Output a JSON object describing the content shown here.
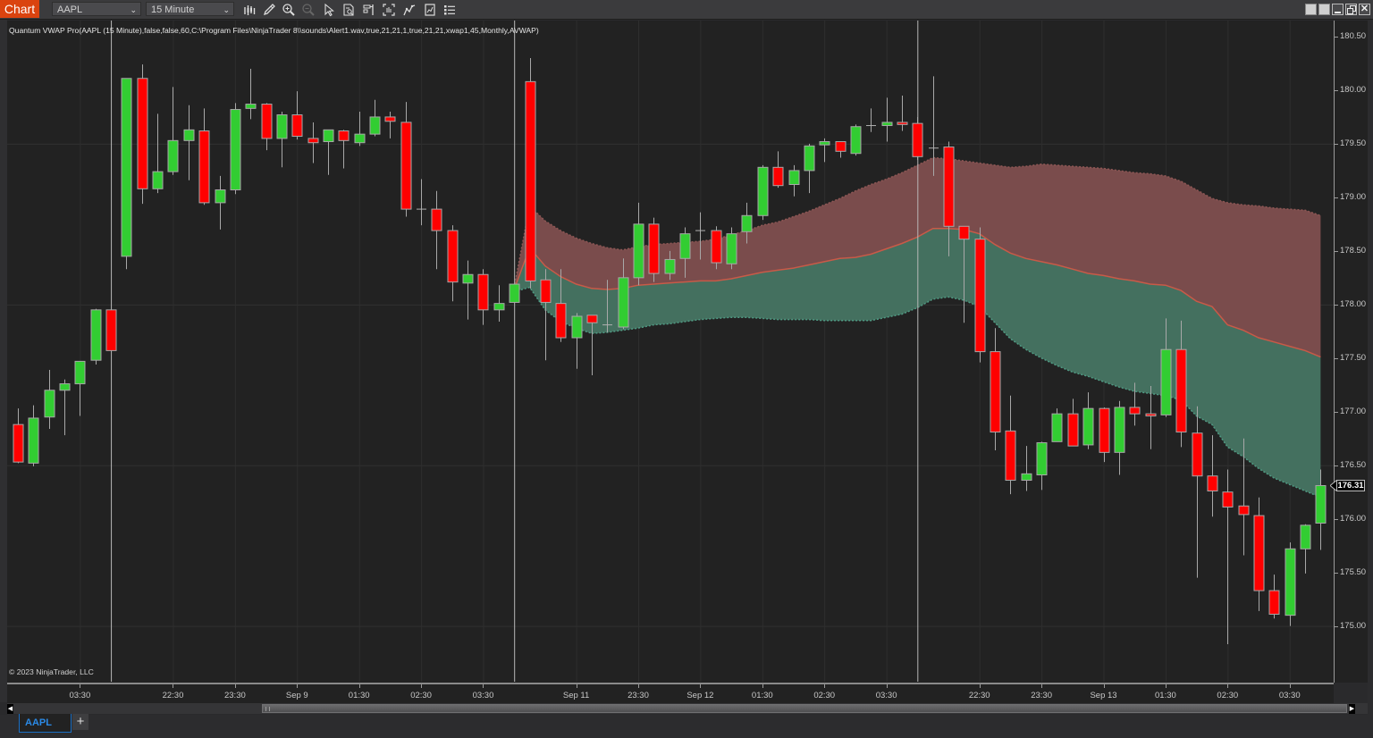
{
  "toolbar": {
    "app_label": "Chart",
    "instrument": "AAPL",
    "timeframe": "15 Minute",
    "icons": [
      "bar-type-icon",
      "drawing-tools-icon",
      "zoom-in-icon",
      "zoom-out-icon",
      "pointer-icon",
      "data-box-icon",
      "chart-trader-icon",
      "snapshot-icon",
      "indicators-icon",
      "strategies-icon",
      "properties-icon"
    ]
  },
  "window_controls": [
    "link-icon",
    "group-icon",
    "minimize-icon",
    "restore-icon",
    "close-icon"
  ],
  "indicator_label": "Quantum VWAP Pro(AAPL (15 Minute),false,false,60,C:\\Program Files\\NinjaTrader 8\\\\sounds\\Alert1.wav,true,21,21,1,true,21,21,xwap1,45,Monthly,AVWAP)",
  "copyright": "© 2023 NinjaTrader, LLC",
  "tabs": [
    {
      "label": "AAPL",
      "active": true
    }
  ],
  "add_tab_label": "+",
  "colors": {
    "up_candle": "#32cd32",
    "down_candle": "#ff0000",
    "candle_outline": "#a8a8a8",
    "upper_band_fill": "#7a4c4c",
    "lower_band_fill": "#44705f",
    "vwap_line": "#c85a48",
    "upper_band_line": "#8e5755",
    "lower_band_line": "#4f9a83",
    "accent": "#da430f"
  },
  "chart_data": {
    "type": "candlestick",
    "title": "Quantum VWAP Pro",
    "instrument": "AAPL",
    "timeframe": "15 Minute",
    "ylabel": "",
    "xlabel": "",
    "ylim": [
      174.48,
      180.65
    ],
    "xlim": [
      -0.69,
      84.84
    ],
    "grid_prices": [
      175.0,
      176.5,
      178.0,
      179.5
    ],
    "y_ticks": [
      {
        "value": 180.5,
        "label": "180.50"
      },
      {
        "value": 180.0,
        "label": "180.00"
      },
      {
        "value": 179.5,
        "label": "179.50"
      },
      {
        "value": 179.0,
        "label": "179.00"
      },
      {
        "value": 178.5,
        "label": "178.50"
      },
      {
        "value": 178.0,
        "label": "178.00"
      },
      {
        "value": 177.5,
        "label": "177.50"
      },
      {
        "value": 177.0,
        "label": "177.00"
      },
      {
        "value": 176.5,
        "label": "176.50"
      },
      {
        "value": 176.0,
        "label": "176.00"
      },
      {
        "value": 175.5,
        "label": "175.50"
      },
      {
        "value": 175.0,
        "label": "175.00"
      }
    ],
    "x_ticks": [
      {
        "i": 4,
        "label": "03:30"
      },
      {
        "i": 10,
        "label": "22:30"
      },
      {
        "i": 14,
        "label": "23:30"
      },
      {
        "i": 18,
        "label": "Sep 9"
      },
      {
        "i": 22,
        "label": "01:30"
      },
      {
        "i": 26,
        "label": "02:30"
      },
      {
        "i": 30,
        "label": "03:30"
      },
      {
        "i": 36,
        "label": "Sep 11"
      },
      {
        "i": 40,
        "label": "23:30"
      },
      {
        "i": 44,
        "label": "Sep 12"
      },
      {
        "i": 48,
        "label": "01:30"
      },
      {
        "i": 52,
        "label": "02:30"
      },
      {
        "i": 56,
        "label": "03:30"
      },
      {
        "i": 62,
        "label": "22:30"
      },
      {
        "i": 66,
        "label": "23:30"
      },
      {
        "i": 70,
        "label": "Sep 13"
      },
      {
        "i": 74,
        "label": "01:30"
      },
      {
        "i": 78,
        "label": "02:30"
      },
      {
        "i": 82,
        "label": "03:30"
      }
    ],
    "session_breaks": [
      6,
      32,
      58
    ],
    "last_price": 176.31,
    "last_price_label": "176.31",
    "candles": [
      {
        "o": 176.88,
        "h": 177.03,
        "l": 176.52,
        "c": 176.53
      },
      {
        "o": 176.52,
        "h": 177.06,
        "l": 176.49,
        "c": 176.94
      },
      {
        "o": 176.95,
        "h": 177.39,
        "l": 176.84,
        "c": 177.2
      },
      {
        "o": 177.2,
        "h": 177.3,
        "l": 176.78,
        "c": 177.26
      },
      {
        "o": 177.26,
        "h": 177.47,
        "l": 176.96,
        "c": 177.47
      },
      {
        "o": 177.48,
        "h": 177.96,
        "l": 177.44,
        "c": 177.95
      },
      {
        "o": 177.95,
        "h": 177.96,
        "l": 177.57,
        "c": 177.57
      },
      {
        "o": 178.45,
        "h": 180.11,
        "l": 178.33,
        "c": 180.11
      },
      {
        "o": 180.11,
        "h": 180.24,
        "l": 178.94,
        "c": 179.08
      },
      {
        "o": 179.08,
        "h": 179.78,
        "l": 179.04,
        "c": 179.24
      },
      {
        "o": 179.24,
        "h": 180.03,
        "l": 179.21,
        "c": 179.53
      },
      {
        "o": 179.53,
        "h": 179.86,
        "l": 179.16,
        "c": 179.63
      },
      {
        "o": 179.62,
        "h": 179.83,
        "l": 178.93,
        "c": 178.95
      },
      {
        "o": 178.95,
        "h": 179.2,
        "l": 178.7,
        "c": 179.07
      },
      {
        "o": 179.07,
        "h": 179.88,
        "l": 179.03,
        "c": 179.82
      },
      {
        "o": 179.83,
        "h": 180.2,
        "l": 179.73,
        "c": 179.87
      },
      {
        "o": 179.87,
        "h": 179.88,
        "l": 179.44,
        "c": 179.55
      },
      {
        "o": 179.55,
        "h": 179.8,
        "l": 179.28,
        "c": 179.77
      },
      {
        "o": 179.77,
        "h": 179.99,
        "l": 179.54,
        "c": 179.57
      },
      {
        "o": 179.55,
        "h": 179.7,
        "l": 179.32,
        "c": 179.51
      },
      {
        "o": 179.52,
        "h": 179.63,
        "l": 179.21,
        "c": 179.63
      },
      {
        "o": 179.62,
        "h": 179.63,
        "l": 179.27,
        "c": 179.53
      },
      {
        "o": 179.51,
        "h": 179.8,
        "l": 179.48,
        "c": 179.59
      },
      {
        "o": 179.59,
        "h": 179.91,
        "l": 179.57,
        "c": 179.75
      },
      {
        "o": 179.75,
        "h": 179.8,
        "l": 179.55,
        "c": 179.71
      },
      {
        "o": 179.7,
        "h": 179.89,
        "l": 178.82,
        "c": 178.89
      },
      {
        "o": 178.89,
        "h": 179.17,
        "l": 178.74,
        "c": 178.89
      },
      {
        "o": 178.89,
        "h": 179.06,
        "l": 178.33,
        "c": 178.69
      },
      {
        "o": 178.69,
        "h": 178.74,
        "l": 178.03,
        "c": 178.21
      },
      {
        "o": 178.2,
        "h": 178.41,
        "l": 177.86,
        "c": 178.28
      },
      {
        "o": 178.28,
        "h": 178.33,
        "l": 177.81,
        "c": 177.95
      },
      {
        "o": 177.95,
        "h": 178.18,
        "l": 177.84,
        "c": 178.01
      },
      {
        "o": 178.02,
        "h": 178.19,
        "l": 178.02,
        "c": 178.19
      },
      {
        "o": 180.08,
        "h": 180.3,
        "l": 178.15,
        "c": 178.22
      },
      {
        "o": 178.23,
        "h": 178.33,
        "l": 177.48,
        "c": 178.02
      },
      {
        "o": 178.01,
        "h": 178.33,
        "l": 177.65,
        "c": 177.69
      },
      {
        "o": 177.69,
        "h": 177.92,
        "l": 177.4,
        "c": 177.89
      },
      {
        "o": 177.9,
        "h": 177.9,
        "l": 177.34,
        "c": 177.83
      },
      {
        "o": 177.81,
        "h": 178.23,
        "l": 177.74,
        "c": 177.81
      },
      {
        "o": 177.79,
        "h": 178.43,
        "l": 177.77,
        "c": 178.25
      },
      {
        "o": 178.25,
        "h": 178.95,
        "l": 178.18,
        "c": 178.75
      },
      {
        "o": 178.75,
        "h": 178.81,
        "l": 178.21,
        "c": 178.29
      },
      {
        "o": 178.29,
        "h": 178.5,
        "l": 178.23,
        "c": 178.42
      },
      {
        "o": 178.43,
        "h": 178.72,
        "l": 178.25,
        "c": 178.66
      },
      {
        "o": 178.68,
        "h": 178.86,
        "l": 178.42,
        "c": 178.69
      },
      {
        "o": 178.69,
        "h": 178.73,
        "l": 178.33,
        "c": 178.39
      },
      {
        "o": 178.38,
        "h": 178.72,
        "l": 178.33,
        "c": 178.66
      },
      {
        "o": 178.68,
        "h": 178.95,
        "l": 178.57,
        "c": 178.83
      },
      {
        "o": 178.83,
        "h": 179.3,
        "l": 178.79,
        "c": 179.28
      },
      {
        "o": 179.28,
        "h": 179.43,
        "l": 179.09,
        "c": 179.11
      },
      {
        "o": 179.12,
        "h": 179.3,
        "l": 179.01,
        "c": 179.25
      },
      {
        "o": 179.25,
        "h": 179.5,
        "l": 179.04,
        "c": 179.48
      },
      {
        "o": 179.49,
        "h": 179.55,
        "l": 179.33,
        "c": 179.52
      },
      {
        "o": 179.52,
        "h": 179.52,
        "l": 179.37,
        "c": 179.43
      },
      {
        "o": 179.41,
        "h": 179.68,
        "l": 179.39,
        "c": 179.66
      },
      {
        "o": 179.67,
        "h": 179.83,
        "l": 179.61,
        "c": 179.67
      },
      {
        "o": 179.67,
        "h": 179.93,
        "l": 179.52,
        "c": 179.7
      },
      {
        "o": 179.7,
        "h": 179.95,
        "l": 179.62,
        "c": 179.68
      },
      {
        "o": 179.69,
        "h": 179.75,
        "l": 179.35,
        "c": 179.38
      },
      {
        "o": 179.45,
        "h": 180.13,
        "l": 179.2,
        "c": 179.46
      },
      {
        "o": 179.47,
        "h": 179.52,
        "l": 178.45,
        "c": 178.73
      },
      {
        "o": 178.73,
        "h": 178.73,
        "l": 177.83,
        "c": 178.61
      },
      {
        "o": 178.61,
        "h": 178.72,
        "l": 177.46,
        "c": 177.56
      },
      {
        "o": 177.56,
        "h": 177.78,
        "l": 176.64,
        "c": 176.81
      },
      {
        "o": 176.82,
        "h": 177.15,
        "l": 176.23,
        "c": 176.36
      },
      {
        "o": 176.36,
        "h": 176.68,
        "l": 176.26,
        "c": 176.42
      },
      {
        "o": 176.41,
        "h": 176.72,
        "l": 176.27,
        "c": 176.71
      },
      {
        "o": 176.72,
        "h": 177.03,
        "l": 176.72,
        "c": 176.98
      },
      {
        "o": 176.98,
        "h": 177.12,
        "l": 176.68,
        "c": 176.68
      },
      {
        "o": 176.69,
        "h": 177.18,
        "l": 176.65,
        "c": 177.03
      },
      {
        "o": 177.03,
        "h": 177.04,
        "l": 176.53,
        "c": 176.62
      },
      {
        "o": 176.62,
        "h": 177.1,
        "l": 176.41,
        "c": 177.04
      },
      {
        "o": 177.04,
        "h": 177.27,
        "l": 176.87,
        "c": 176.98
      },
      {
        "o": 176.98,
        "h": 177.24,
        "l": 176.65,
        "c": 176.96
      },
      {
        "o": 176.97,
        "h": 177.87,
        "l": 176.95,
        "c": 177.58
      },
      {
        "o": 177.58,
        "h": 177.85,
        "l": 176.67,
        "c": 176.81
      },
      {
        "o": 176.8,
        "h": 177.05,
        "l": 175.45,
        "c": 176.4
      },
      {
        "o": 176.4,
        "h": 176.78,
        "l": 176.02,
        "c": 176.26
      },
      {
        "o": 176.25,
        "h": 176.46,
        "l": 174.83,
        "c": 176.11
      },
      {
        "o": 176.12,
        "h": 176.75,
        "l": 175.66,
        "c": 176.04
      },
      {
        "o": 176.03,
        "h": 176.2,
        "l": 175.14,
        "c": 175.33
      },
      {
        "o": 175.33,
        "h": 175.48,
        "l": 175.07,
        "c": 175.11
      },
      {
        "o": 175.1,
        "h": 175.78,
        "l": 175.0,
        "c": 175.72
      },
      {
        "o": 175.72,
        "h": 175.95,
        "l": 175.49,
        "c": 175.94
      },
      {
        "o": 175.96,
        "h": 176.46,
        "l": 175.71,
        "c": 176.31
      }
    ],
    "series": [
      {
        "name": "Upper Band",
        "start_index": 32,
        "values": [
          178.16,
          178.92,
          178.78,
          178.69,
          178.62,
          178.57,
          178.53,
          178.51,
          178.54,
          178.56,
          178.57,
          178.58,
          178.59,
          178.61,
          178.65,
          178.69,
          178.74,
          178.77,
          178.82,
          178.87,
          178.93,
          178.99,
          179.06,
          179.12,
          179.17,
          179.23,
          179.3,
          179.37,
          179.36,
          179.34,
          179.32,
          179.3,
          179.28,
          179.29,
          179.31,
          179.3,
          179.29,
          179.28,
          179.27,
          179.25,
          179.23,
          179.22,
          179.2,
          179.15,
          179.07,
          178.99,
          178.95,
          178.93,
          178.92,
          178.9,
          178.89,
          178.88,
          178.83
        ]
      },
      {
        "name": "AVWAP",
        "start_index": 32,
        "values": [
          178.14,
          178.53,
          178.36,
          178.26,
          178.19,
          178.15,
          178.14,
          178.15,
          178.18,
          178.19,
          178.2,
          178.21,
          178.22,
          178.22,
          178.24,
          178.27,
          178.3,
          178.32,
          178.34,
          178.37,
          178.4,
          178.43,
          178.44,
          178.47,
          178.52,
          178.57,
          178.63,
          178.71,
          178.71,
          178.7,
          178.66,
          178.56,
          178.48,
          178.43,
          178.4,
          178.37,
          178.33,
          178.29,
          178.27,
          178.24,
          178.22,
          178.19,
          178.18,
          178.13,
          178.03,
          177.98,
          177.81,
          177.76,
          177.69,
          177.65,
          177.61,
          177.57,
          177.51
        ]
      },
      {
        "name": "Lower Band",
        "start_index": 32,
        "values": [
          178.12,
          178.16,
          177.95,
          177.84,
          177.78,
          177.73,
          177.74,
          177.76,
          177.78,
          177.81,
          177.82,
          177.84,
          177.86,
          177.87,
          177.88,
          177.88,
          177.87,
          177.86,
          177.86,
          177.86,
          177.85,
          177.85,
          177.85,
          177.85,
          177.88,
          177.91,
          177.97,
          178.05,
          178.07,
          178.04,
          177.98,
          177.83,
          177.68,
          177.58,
          177.5,
          177.43,
          177.37,
          177.33,
          177.28,
          177.23,
          177.19,
          177.17,
          177.15,
          177.11,
          176.96,
          176.88,
          176.67,
          176.58,
          176.47,
          176.38,
          176.32,
          176.26,
          176.2
        ]
      }
    ]
  }
}
